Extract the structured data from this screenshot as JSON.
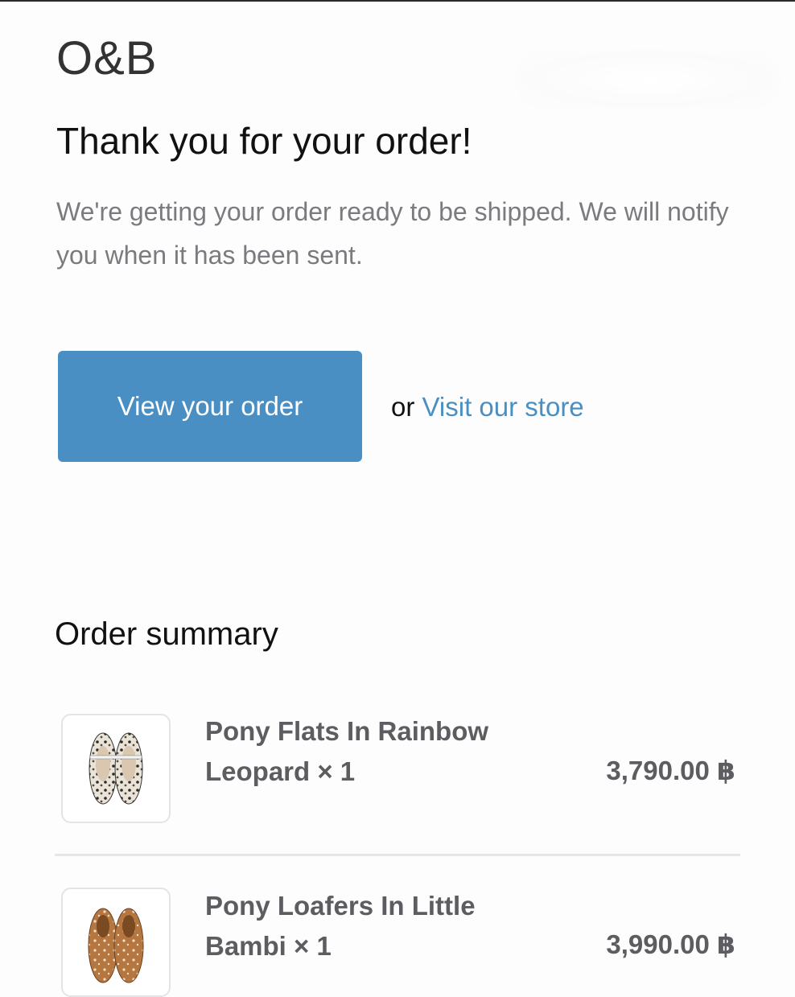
{
  "brand": {
    "name": "O&B"
  },
  "confirmation": {
    "headline": "Thank you for your order!",
    "message": "We're getting your order ready to be shipped. We will notify you when it has been sent."
  },
  "actions": {
    "view_order_label": "View your order",
    "or_text": "or",
    "visit_store_label": "Visit our store"
  },
  "summary": {
    "title": "Order summary",
    "items": [
      {
        "name": "Pony Flats In Rainbow Leopard × 1",
        "price": "3,790.00 ฿",
        "image_icon": "leopard-flats-icon"
      },
      {
        "name": "Pony Loafers In Little Bambi × 1",
        "price": "3,990.00 ฿",
        "image_icon": "bambi-loafers-icon"
      }
    ]
  },
  "colors": {
    "accent": "#4a8fc3",
    "muted_text": "#7b7b7f",
    "item_text": "#5d5d61"
  }
}
